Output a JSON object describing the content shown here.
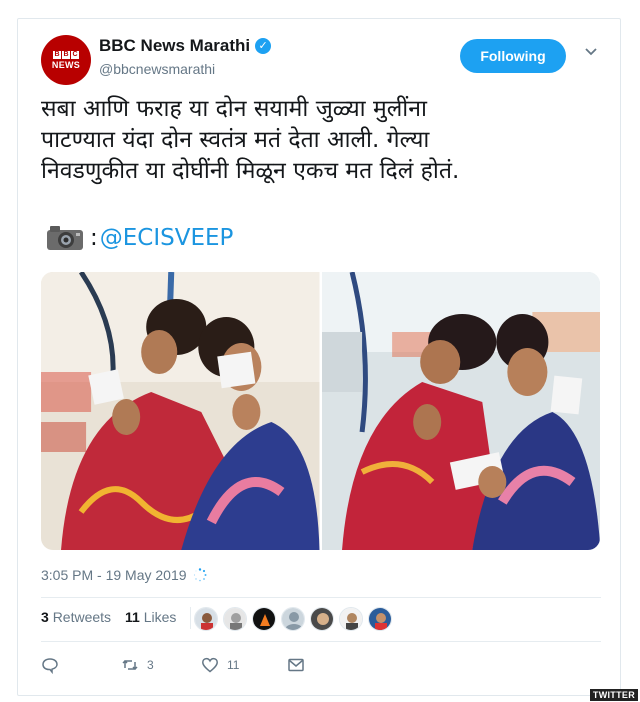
{
  "account": {
    "name": "BBC News Marathi",
    "handle": "@bbcnewsmarathi",
    "avatar_logo_text": "BBC NEWS",
    "verified": true
  },
  "follow_button": {
    "label": "Following"
  },
  "tweet": {
    "text": "सबा आणि फराह या दोन सयामी जुळ्या मुलींना\nपाटण्यात यंदा दोन स्वतंत्र मतं देता आली. गेल्या\nनिवडणुकीत या दोघींनी मिळून एकच मत दिलं होतं.",
    "credit_separator": ":",
    "mention": "@ECISVEEP"
  },
  "timestamp": "3:05 PM - 19 May 2019",
  "stats": {
    "retweets_count": "3",
    "retweets_label": "Retweets",
    "likes_count": "11",
    "likes_label": "Likes"
  },
  "actions": {
    "reply_icon": "reply-icon",
    "retweet_count": "3",
    "like_count": "11",
    "dm_icon": "envelope-icon"
  },
  "watermark": "TWITTER",
  "colors": {
    "accent": "#1da1f2",
    "link": "#1b95e0",
    "brand_red": "#b80000",
    "muted": "#657786"
  }
}
